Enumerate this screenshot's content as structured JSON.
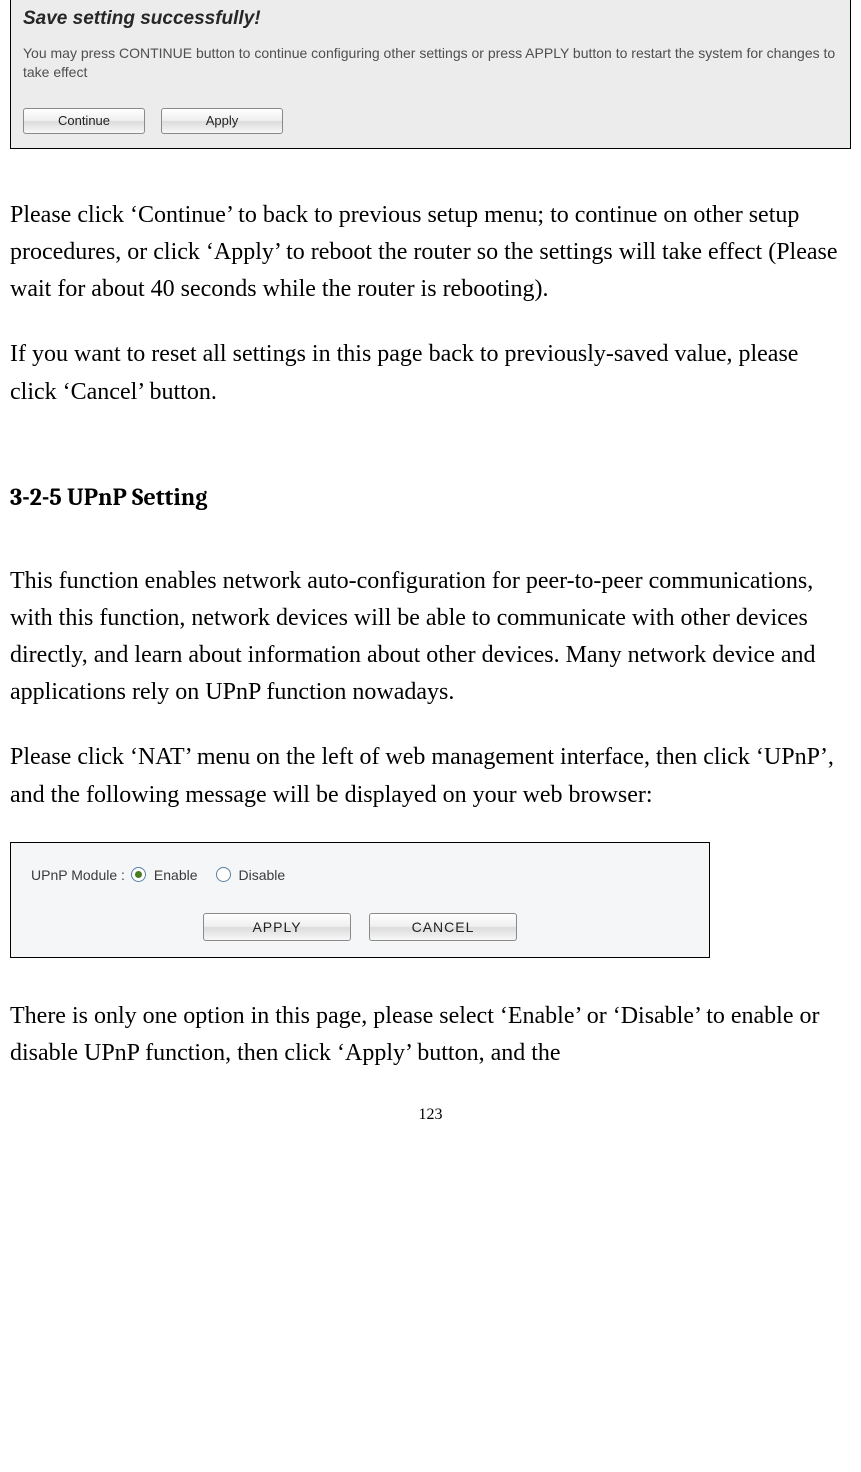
{
  "dialog1": {
    "title": "Save setting successfully!",
    "description": "You may press CONTINUE button to continue configuring other settings or press APPLY button to restart the system for changes to take effect",
    "continue_label": "Continue",
    "apply_label": "Apply"
  },
  "paragraphs": {
    "p1": "Please click ‘Continue’ to back to previous setup menu; to continue on other setup procedures, or click ‘Apply’ to reboot the router so the settings will take effect (Please wait for about 40 seconds while the router is rebooting).",
    "p2": "If you want to reset all settings in this page back to previously-saved value, please click ‘Cancel’ button.",
    "heading": "3-2-5 UPnP Setting",
    "p3": "This function enables network auto-configuration for peer-to-peer communications, with this function, network devices will be able to communicate with other devices directly, and learn about information about other devices. Many network device and applications rely on UPnP function nowadays.",
    "p4": "Please click ‘NAT’ menu on the left of web management interface, then click ‘UPnP’, and the following message will be displayed on your web browser:",
    "p5": "There is only one option in this page, please select ‘Enable’ or ‘Disable’ to enable or disable UPnP function, then click ‘Apply’ button, and the"
  },
  "dialog2": {
    "label": "UPnP Module :",
    "option_enable": "Enable",
    "option_disable": "Disable",
    "selected": "Enable",
    "apply_label": "APPLY",
    "cancel_label": "CANCEL"
  },
  "page_number": "123"
}
